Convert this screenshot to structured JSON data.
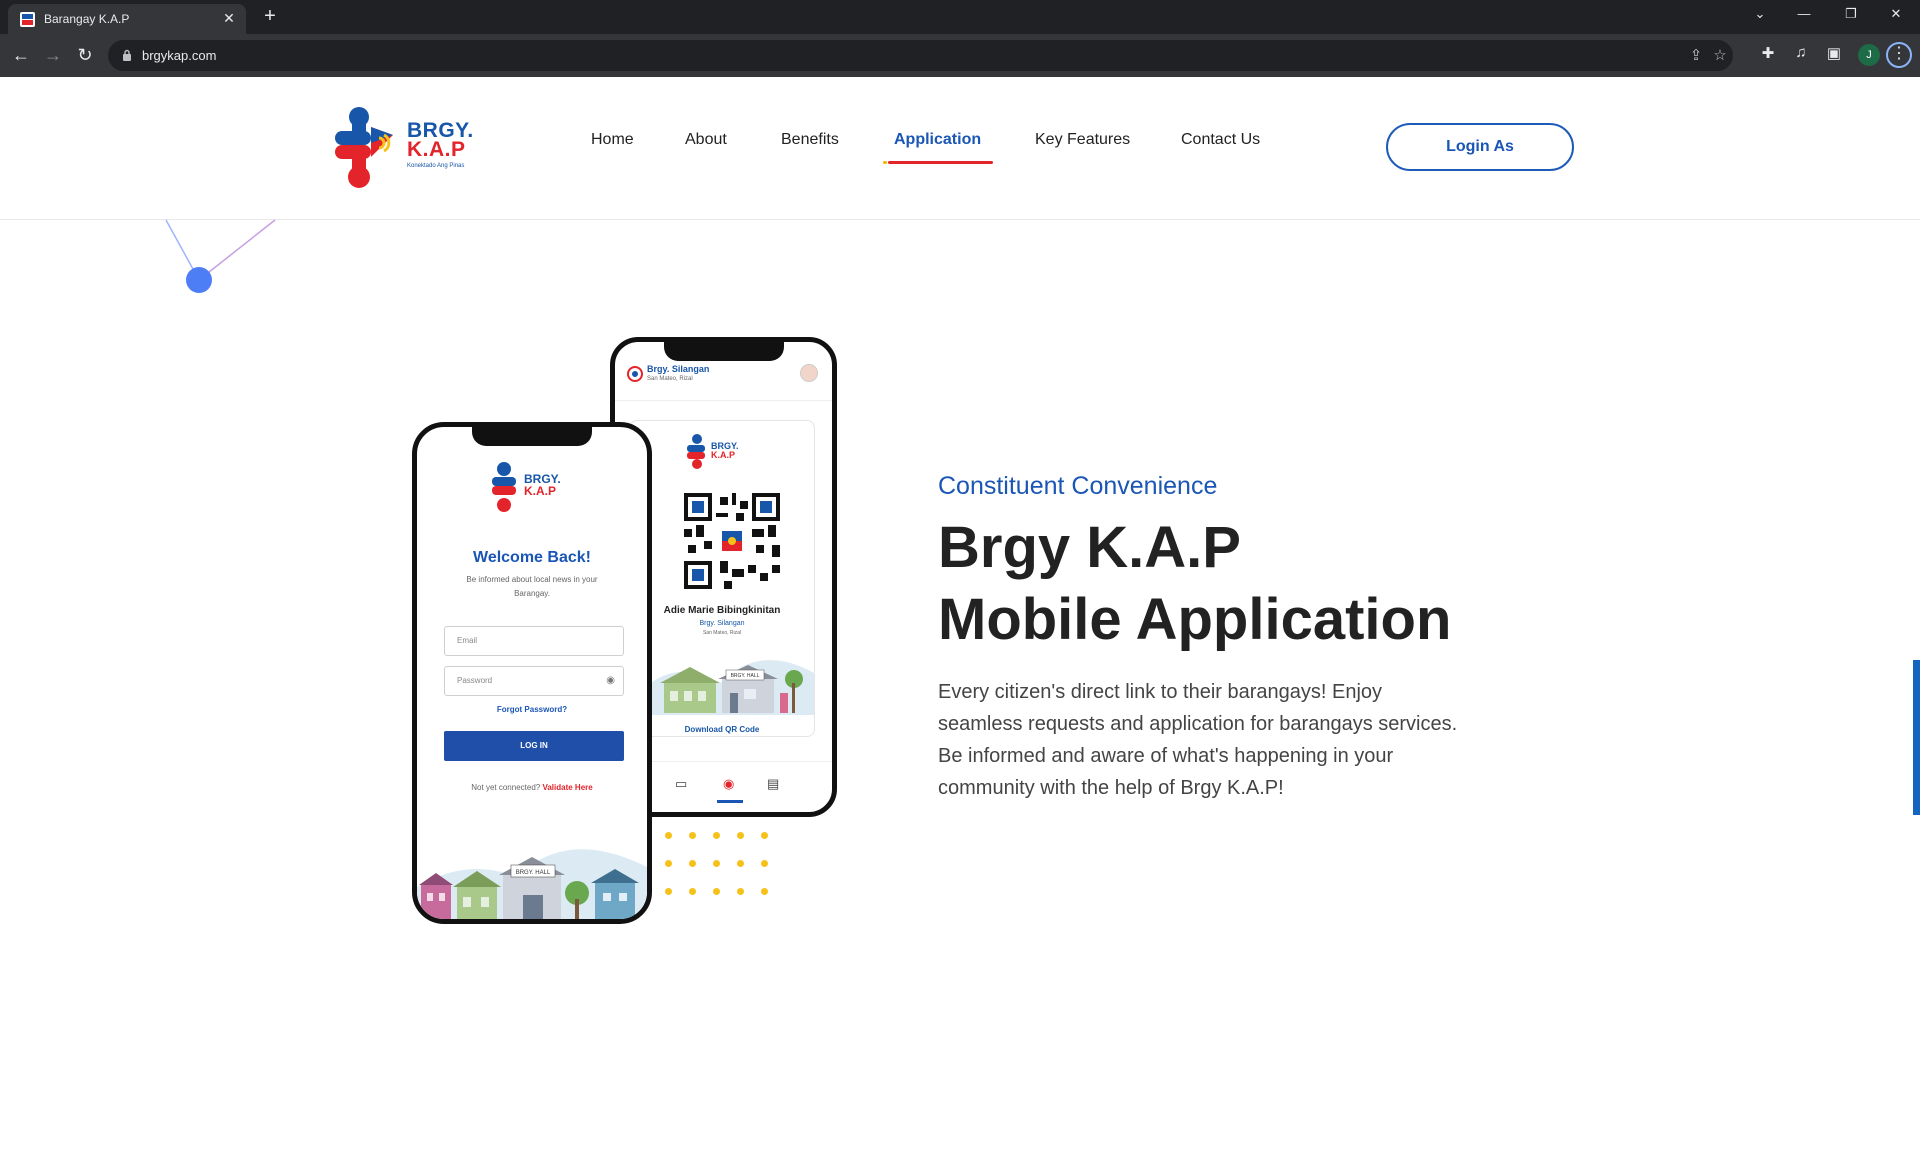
{
  "browser": {
    "tab_title": "Barangay K.A.P",
    "tab_close": "✕",
    "new_tab": "+",
    "url": "brgykap.com",
    "profile_initial": "J"
  },
  "site": {
    "logo": {
      "line1": "BRGY.",
      "line2": "K.A.P",
      "tagline": "Konektado Ang Pinas"
    },
    "nav": [
      {
        "label": "Home"
      },
      {
        "label": "About"
      },
      {
        "label": "Benefits"
      },
      {
        "label": "Application",
        "active": true
      },
      {
        "label": "Key Features"
      },
      {
        "label": "Contact Us"
      }
    ],
    "login_label": "Login As"
  },
  "phone_back": {
    "brgy": "Brgy. Silangan",
    "location": "San Mateo, Rizal",
    "logo_line1": "BRGY.",
    "logo_line2": "K.A.P",
    "user_name": "Adie Marie Bibingkinitan",
    "brgy2": "Brgy. Silangan",
    "location2": "San Mateo, Rizal",
    "hall_sign": "BRGY. HALL",
    "download": "Download QR Code"
  },
  "phone_front": {
    "logo_line1": "BRGY.",
    "logo_line2": "K.A.P",
    "welcome": "Welcome Back!",
    "subtitle": "Be informed about local news in your Barangay.",
    "email_placeholder": "Email",
    "password_placeholder": "Password",
    "forgot": "Forgot Password?",
    "login_button": "LOG IN",
    "not_yet": "Not yet connected?",
    "validate": "Validate Here",
    "hall_sign": "BRGY. HALL"
  },
  "section": {
    "eyebrow": "Constituent Convenience",
    "headline_line1": "Brgy K.A.P",
    "headline_line2": "Mobile Application",
    "body": "Every citizen's direct link to their barangays! Enjoy seamless requests and application for barangays services. Be informed and aware of what's happening in your community with the help of Brgy K.A.P!"
  },
  "colors": {
    "brand_blue": "#1a56b5",
    "brand_red": "#e3242b",
    "accent_yellow": "#f6c21a"
  }
}
